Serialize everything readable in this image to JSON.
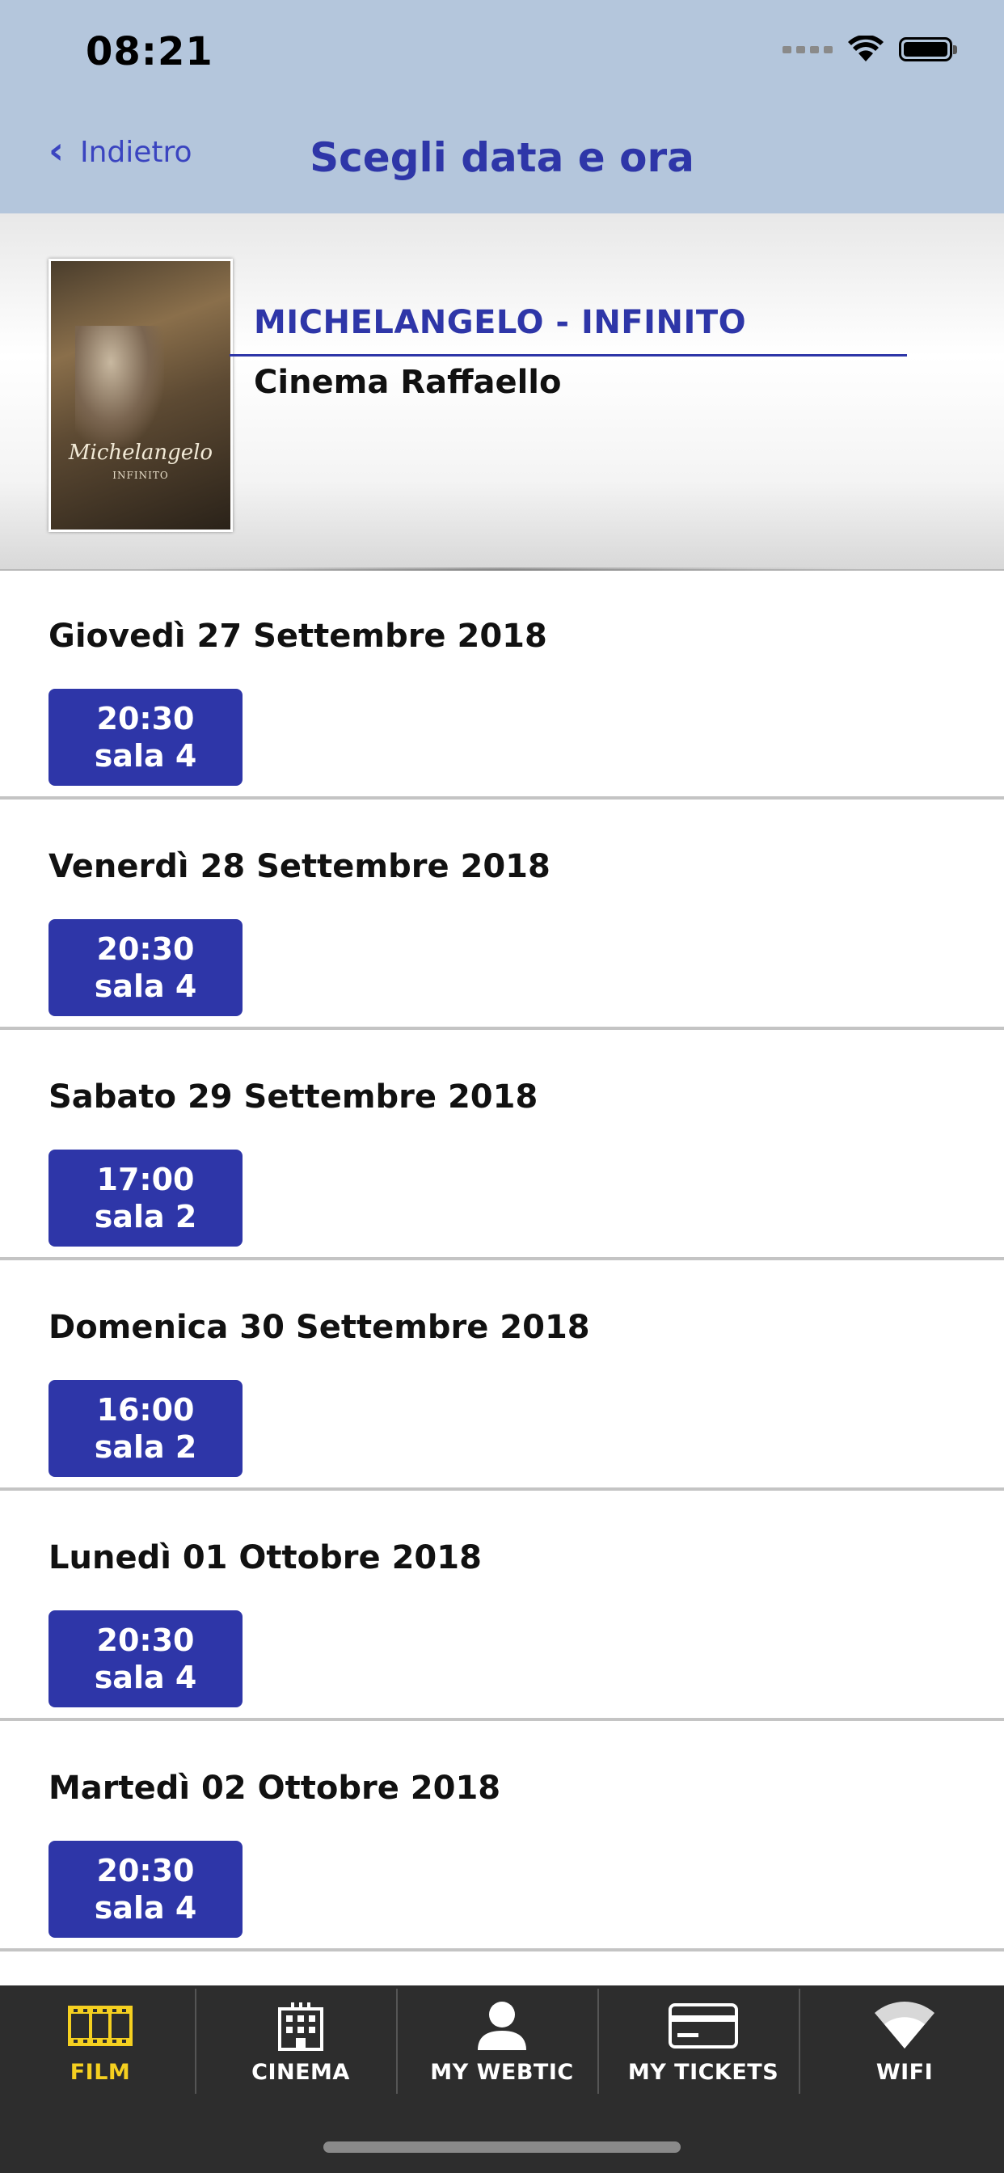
{
  "status_bar": {
    "time": "08:21"
  },
  "nav": {
    "back_label": "Indietro",
    "title": "Scegli data e ora"
  },
  "movie": {
    "title": "MICHELANGELO - INFINITO",
    "cinema": "Cinema Raffaello",
    "poster_text": "Michelangelo",
    "poster_subtext": "INFINITO"
  },
  "schedule": [
    {
      "date": "Giovedì 27 Settembre 2018",
      "time": "20:30",
      "room": "sala 4"
    },
    {
      "date": "Venerdì 28 Settembre 2018",
      "time": "20:30",
      "room": "sala 4"
    },
    {
      "date": "Sabato 29 Settembre 2018",
      "time": "17:00",
      "room": "sala 2"
    },
    {
      "date": "Domenica 30 Settembre 2018",
      "time": "16:00",
      "room": "sala 2"
    },
    {
      "date": "Lunedì 01 Ottobre 2018",
      "time": "20:30",
      "room": "sala 4"
    },
    {
      "date": "Martedì 02 Ottobre 2018",
      "time": "20:30",
      "room": "sala 4"
    }
  ],
  "tabs": [
    {
      "label": "FILM",
      "icon": "film-icon",
      "active": true
    },
    {
      "label": "CINEMA",
      "icon": "cinema-building-icon",
      "active": false
    },
    {
      "label": "MY WEBTIC",
      "icon": "user-icon",
      "active": false
    },
    {
      "label": "MY TICKETS",
      "icon": "credit-card-icon",
      "active": false
    },
    {
      "label": "WIFI",
      "icon": "wifi-icon",
      "active": false
    }
  ],
  "colors": {
    "accent": "#2e36a8",
    "nav_background": "#b4c6dc",
    "tab_active": "#f5d020",
    "tabbar": "#2d2d2d"
  }
}
